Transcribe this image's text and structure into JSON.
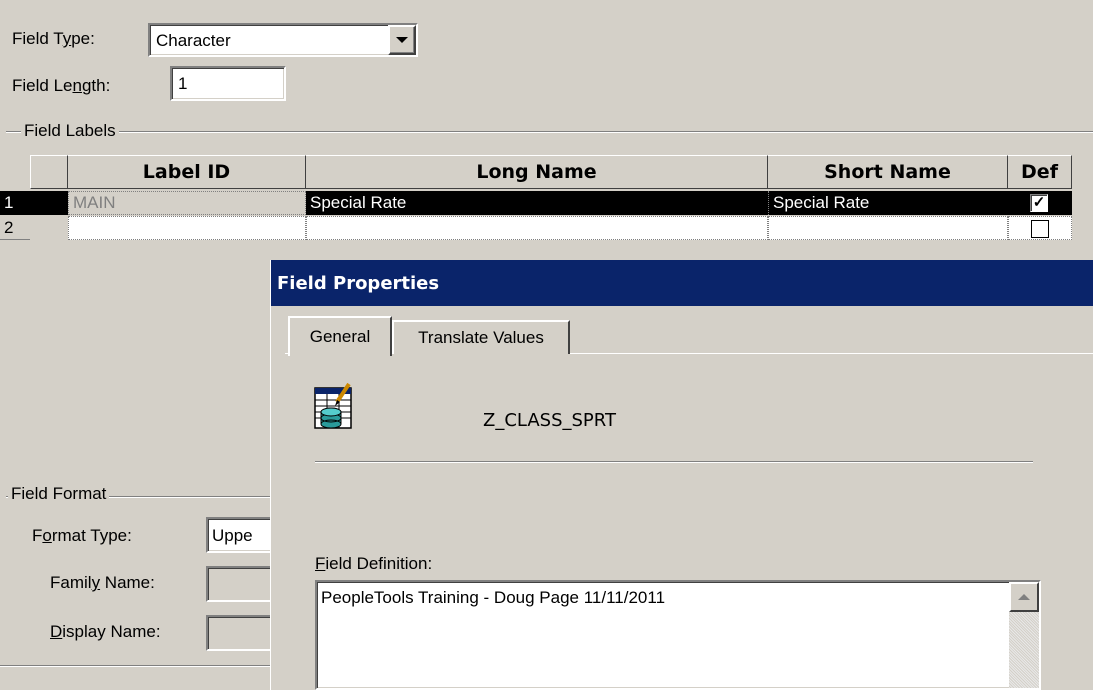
{
  "field": {
    "type_label": "Field Type:",
    "type_value": "Character",
    "length_label": "Field Length:",
    "length_value": "1"
  },
  "labels_group": {
    "title": "Field Labels",
    "columns": [
      "Label ID",
      "Long Name",
      "Short Name",
      "Def"
    ],
    "rows": [
      {
        "num": "1",
        "label_id": "MAIN",
        "long_name": "Special Rate",
        "short_name": "Special Rate",
        "def": true
      },
      {
        "num": "2",
        "label_id": "",
        "long_name": "",
        "short_name": "",
        "def": false
      }
    ]
  },
  "format_group": {
    "title": "Field Format",
    "format_type_label": "Format Type:",
    "format_type_value": "Uppe",
    "family_name_label": "Family Name:",
    "display_name_label": "Display Name:"
  },
  "dialog": {
    "title": "Field Properties",
    "tabs": [
      "General",
      "Translate Values"
    ],
    "field_name": "Z_CLASS_SPRT",
    "definition_label": "Field Definition:",
    "definition_text": "PeopleTools Training - Doug Page 11/11/2011",
    "icon": "record-field-icon"
  },
  "colors": {
    "titlebar": "#0a246a",
    "selected_row": "#000000",
    "face": "#d4d0c8"
  }
}
